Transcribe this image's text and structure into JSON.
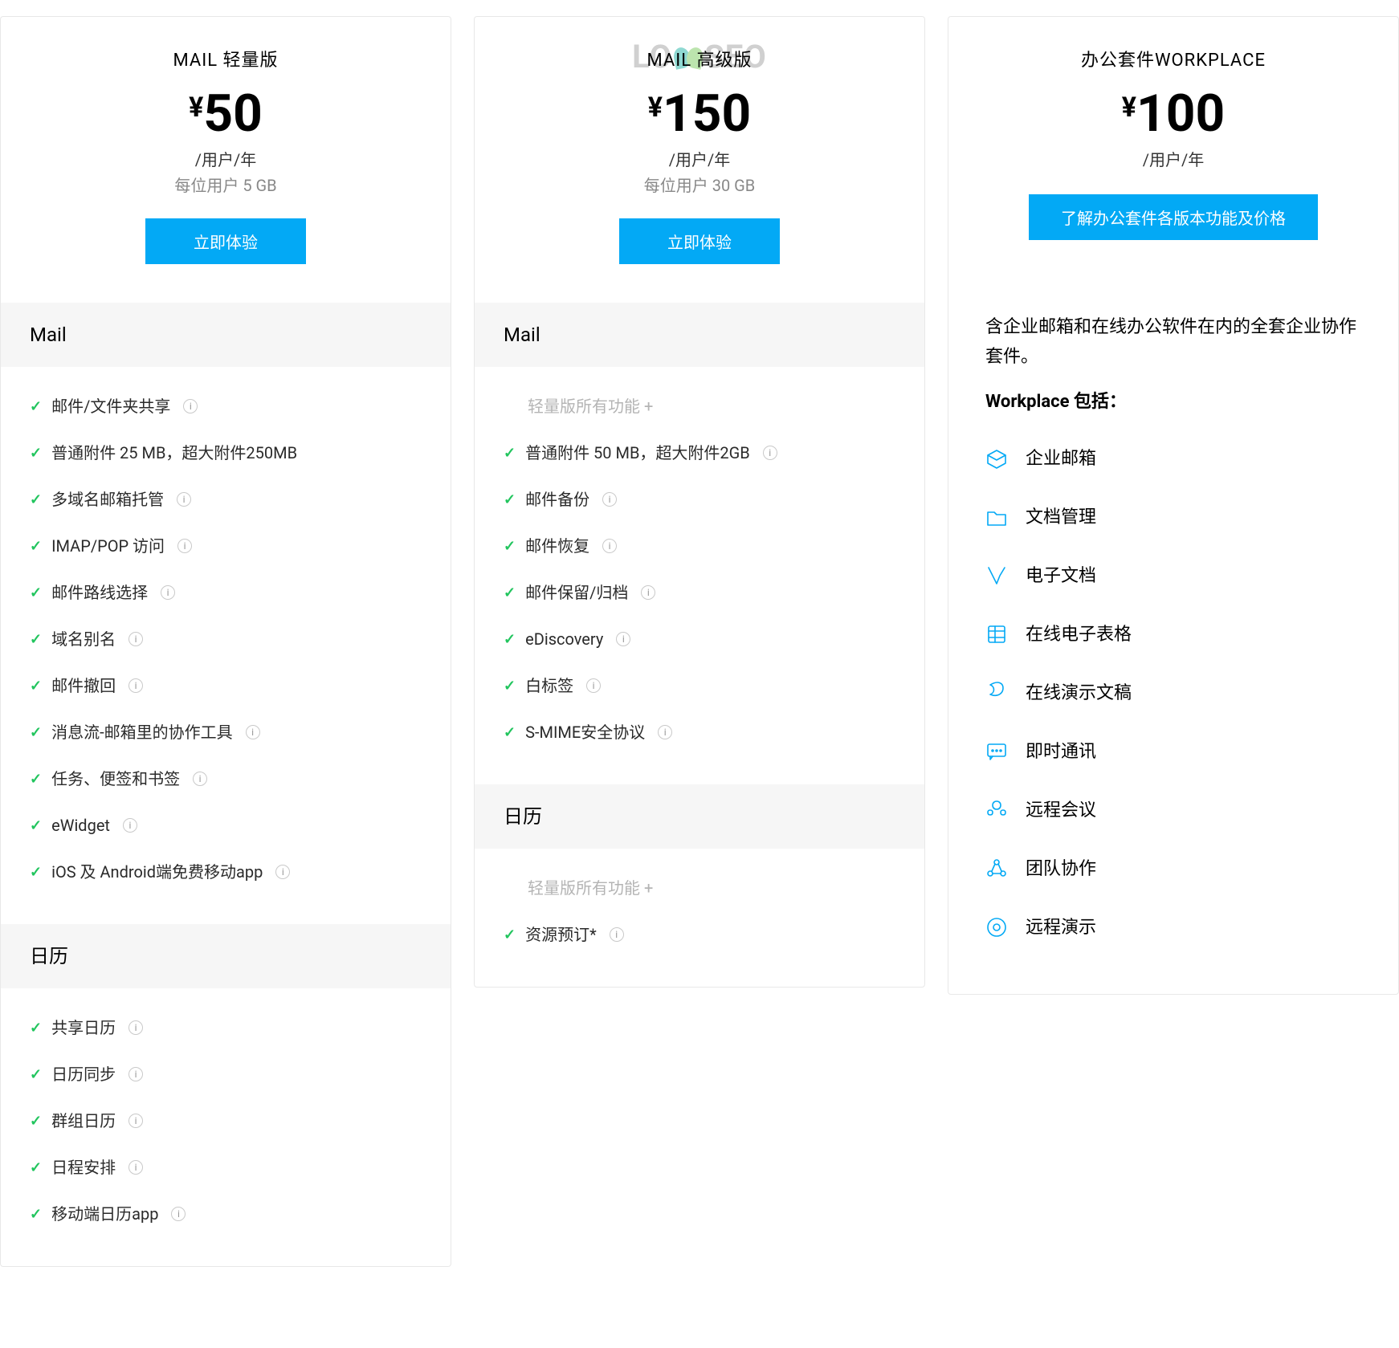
{
  "plans": [
    {
      "title": "MAIL 轻量版",
      "currency": "¥",
      "amount": "50",
      "unit": "/用户/年",
      "storage": "每位用户 5 GB",
      "cta": "立即体验",
      "sections": [
        {
          "title": "Mail",
          "items": [
            {
              "text": "邮件/文件夹共享",
              "info": true
            },
            {
              "text": "普通附件 25 MB，超大附件250MB"
            },
            {
              "text": "多域名邮箱托管",
              "info": true
            },
            {
              "text": "IMAP/POP 访问",
              "info": true
            },
            {
              "text": "邮件路线选择",
              "info": true
            },
            {
              "text": "域名别名",
              "info": true
            },
            {
              "text": "邮件撤回",
              "info": true
            },
            {
              "text": "消息流-邮箱里的协作工具",
              "info": true
            },
            {
              "text": "任务、便签和书签",
              "info": true
            },
            {
              "text": "eWidget",
              "info": true
            },
            {
              "text": "iOS 及 Android端免费移动app",
              "info": true
            }
          ]
        },
        {
          "title": "日历",
          "items": [
            {
              "text": "共享日历",
              "info": true
            },
            {
              "text": "日历同步",
              "info": true
            },
            {
              "text": "群组日历",
              "info": true
            },
            {
              "text": "日程安排",
              "info": true
            },
            {
              "text": "移动端日历app",
              "info": true
            }
          ]
        }
      ]
    },
    {
      "title": "MAIL 高级版",
      "currency": "¥",
      "amount": "150",
      "unit": "/用户/年",
      "storage": "每位用户 30 GB",
      "cta": "立即体验",
      "watermark": {
        "left": "LO",
        "right": "SEO"
      },
      "sections": [
        {
          "title": "Mail",
          "items": [
            {
              "note": true,
              "text": "轻量版所有功能 +"
            },
            {
              "text": "普通附件 50 MB，超大附件2GB",
              "info": true
            },
            {
              "text": "邮件备份",
              "info": true
            },
            {
              "text": "邮件恢复",
              "info": true
            },
            {
              "text": "邮件保留/归档",
              "info": true
            },
            {
              "text": "eDiscovery",
              "info": true
            },
            {
              "text": "白标签",
              "info": true
            },
            {
              "text": "S-MIME安全协议",
              "info": true
            }
          ]
        },
        {
          "title": "日历",
          "items": [
            {
              "note": true,
              "text": "轻量版所有功能 +"
            },
            {
              "text": "资源预订*",
              "info": true
            }
          ]
        }
      ]
    },
    {
      "title": "办公套件WORKPLACE",
      "currency": "¥",
      "amount": "100",
      "unit": "/用户/年",
      "storage": "",
      "cta": "了解办公套件各版本功能及价格",
      "workplace": {
        "intro": "含企业邮箱和在线办公软件在内的全套企业协作套件。",
        "heading": "Workplace 包括：",
        "items": [
          {
            "icon": "mail",
            "text": "企业邮箱"
          },
          {
            "icon": "folder",
            "text": "文档管理"
          },
          {
            "icon": "writer",
            "text": "电子文档"
          },
          {
            "icon": "sheet",
            "text": "在线电子表格"
          },
          {
            "icon": "show",
            "text": "在线演示文稿"
          },
          {
            "icon": "chat",
            "text": "即时通讯"
          },
          {
            "icon": "meeting",
            "text": "远程会议"
          },
          {
            "icon": "connect",
            "text": "团队协作"
          },
          {
            "icon": "remote",
            "text": "远程演示"
          }
        ]
      }
    }
  ],
  "icon_info_char": "i"
}
